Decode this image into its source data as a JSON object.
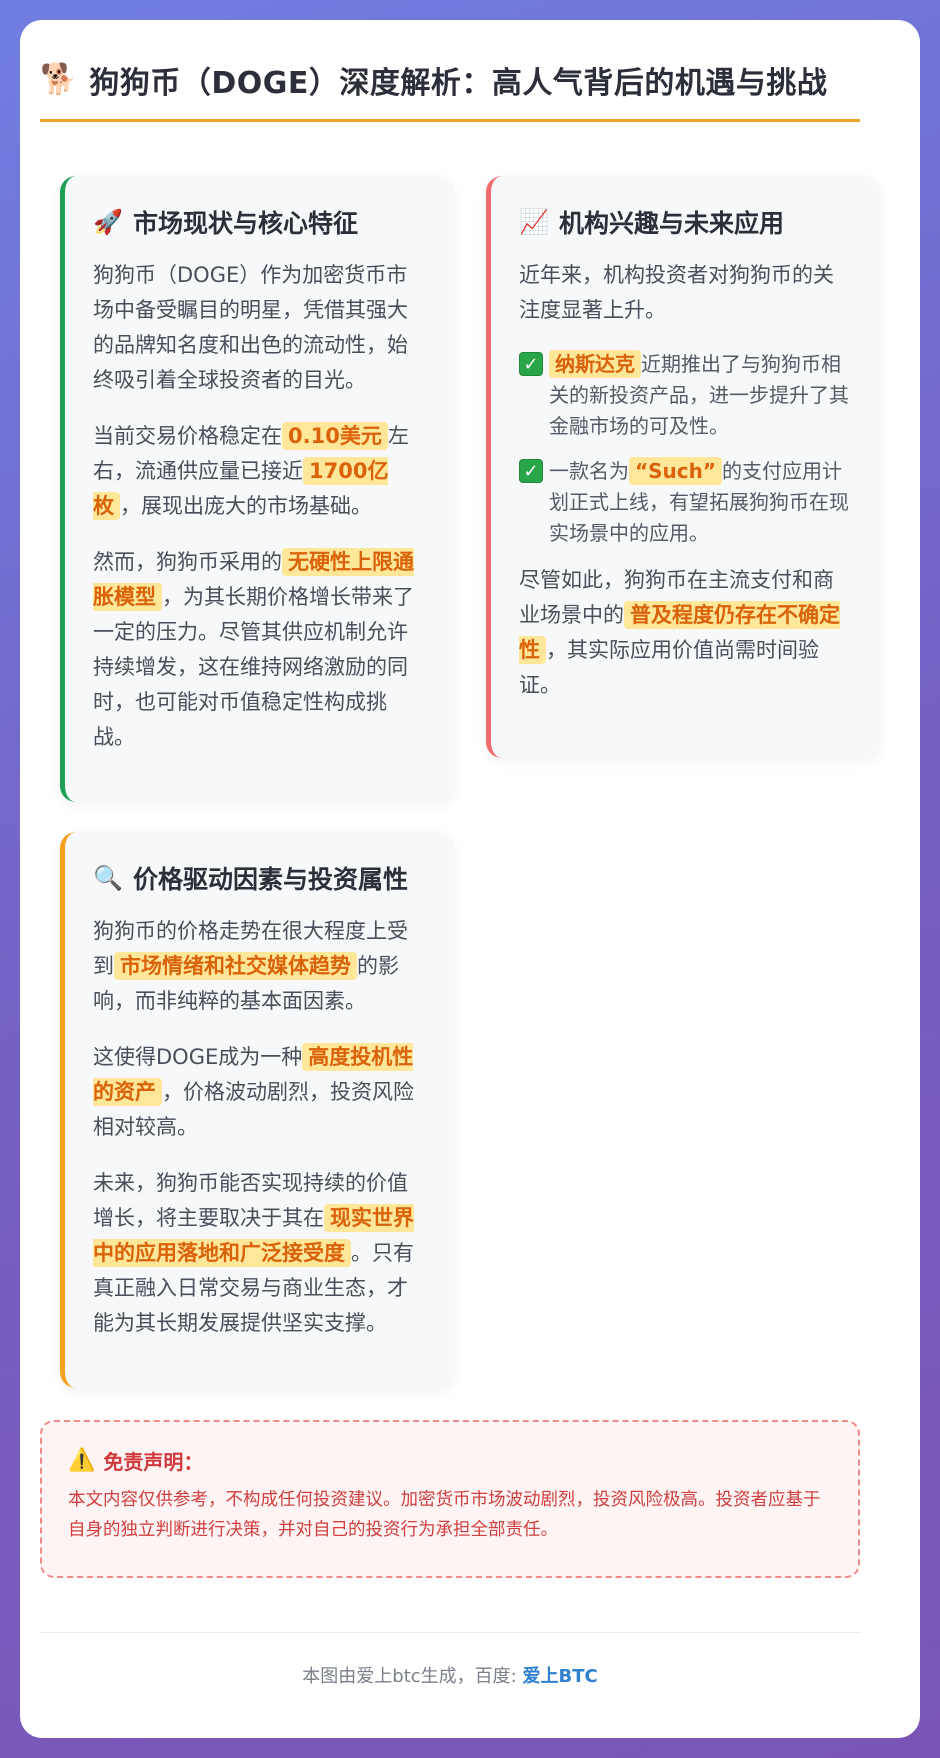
{
  "header": {
    "icon": "🐕",
    "title": "狗狗币（DOGE）深度解析：高人气背后的机遇与挑战"
  },
  "sections": {
    "market": {
      "icon": "🚀",
      "title": "市场现状与核心特征",
      "p1": "狗狗币（DOGE）作为加密货币市场中备受瞩目的明星，凭借其强大的品牌知名度和出色的流动性，始终吸引着全球投资者的目光。",
      "p2_a": "当前交易价格稳定在",
      "p2_hl1": "0.10美元",
      "p2_b": "左右，流通供应量已接近",
      "p2_hl2": "1700亿枚",
      "p2_c": "，展现出庞大的市场基础。",
      "p3_a": "然而，狗狗币采用的",
      "p3_hl": "无硬性上限通胀模型",
      "p3_b": "，为其长期价格增长带来了一定的压力。尽管其供应机制允许持续增发，这在维持网络激励的同时，也可能对币值稳定性构成挑战。"
    },
    "institution": {
      "icon": "📈",
      "title": "机构兴趣与未来应用",
      "p1": "近年来，机构投资者对狗狗币的关注度显著上升。",
      "item1_hl": "纳斯达克",
      "item1_text": "近期推出了与狗狗币相关的新投资产品，进一步提升了其金融市场的可及性。",
      "item2_a": "一款名为",
      "item2_hl": "“Such”",
      "item2_b": "的支付应用计划正式上线，有望拓展狗狗币在现实场景中的应用。",
      "p2_a": "尽管如此，狗狗币在主流支付和商业场景中的",
      "p2_hl": "普及程度仍存在不确定性",
      "p2_b": "，其实际应用价值尚需时间验证。"
    },
    "price": {
      "icon": "🔍",
      "title": "价格驱动因素与投资属性",
      "p1_a": "狗狗币的价格走势在很大程度上受到",
      "p1_hl": "市场情绪和社交媒体趋势",
      "p1_b": "的影响，而非纯粹的基本面因素。",
      "p2_a": "这使得DOGE成为一种",
      "p2_hl": "高度投机性的资产",
      "p2_b": "，价格波动剧烈，投资风险相对较高。",
      "p3_a": "未来，狗狗币能否实现持续的价值增长，将主要取决于其在",
      "p3_hl": "现实世界中的应用落地和广泛接受度",
      "p3_b": "。只有真正融入日常交易与商业生态，才能为其长期发展提供坚实支撑。"
    }
  },
  "disclaimer": {
    "icon": "⚠️",
    "title": "免责声明：",
    "text": "本文内容仅供参考，不构成任何投资建议。加密货币市场波动剧烈，投资风险极高。投资者应基于自身的独立判断进行决策，并对自己的投资行为承担全部责任。"
  },
  "footer": {
    "text": "本图由爱上btc生成，百度: ",
    "brand": "爱上BTC"
  },
  "colors": {
    "accent_orange": "#f0a127",
    "green_border": "#1fa055",
    "red_border": "#f06b6b",
    "orange_border": "#f5a11f",
    "highlight_bg": "#ffe79a",
    "highlight_text": "#d9620a",
    "disclaimer_red": "#cf3f3f",
    "brand_blue": "#2f80d0"
  }
}
